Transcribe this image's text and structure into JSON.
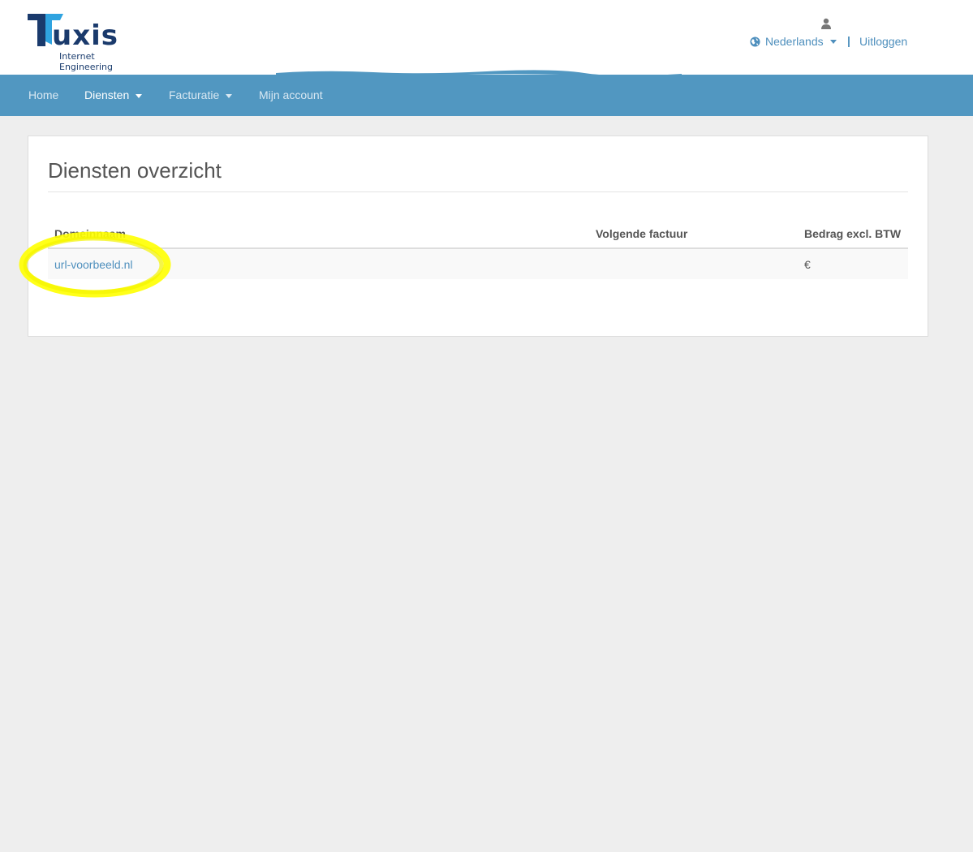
{
  "header": {
    "logo_text": "Tuxis",
    "logo_subtitle": "Internet Engineering",
    "language_label": "Nederlands",
    "separator": "|",
    "logout_label": "Uitloggen"
  },
  "nav": {
    "items": [
      {
        "label": "Home",
        "dropdown": false,
        "active": false
      },
      {
        "label": "Diensten",
        "dropdown": true,
        "active": true
      },
      {
        "label": "Facturatie",
        "dropdown": true,
        "active": false
      },
      {
        "label": "Mijn account",
        "dropdown": false,
        "active": false
      }
    ]
  },
  "main": {
    "title": "Diensten overzicht",
    "table": {
      "columns": [
        "Domeinnaam",
        "Volgende factuur",
        "Bedrag excl. BTW"
      ],
      "rows": [
        {
          "domain": "url-voorbeeld.nl",
          "next_invoice": "",
          "amount": "€"
        }
      ]
    }
  },
  "colors": {
    "accent": "#5197c1",
    "link": "#4e8fbd",
    "highlight": "#ffff00",
    "background": "#eeeeee"
  }
}
